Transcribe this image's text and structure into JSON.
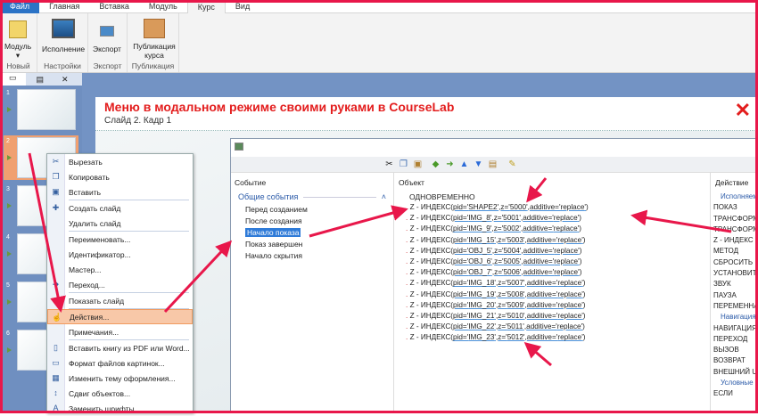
{
  "ribbon": {
    "tabs": [
      "Файл",
      "Главная",
      "Вставка",
      "Модуль",
      "Курс",
      "Вид"
    ],
    "active_tab": "Курс",
    "groups": [
      {
        "label": "Новый",
        "buttons": [
          "Модуль"
        ]
      },
      {
        "label": "Настройки",
        "buttons": [
          "Исполнение"
        ]
      },
      {
        "label": "Экспорт",
        "buttons": [
          "Экспорт"
        ]
      },
      {
        "label": "Публикация",
        "buttons": [
          "Публикация курса"
        ]
      }
    ]
  },
  "slides": {
    "numbers": [
      "1",
      "2",
      "3",
      "4",
      "5",
      "6"
    ],
    "selected": "2"
  },
  "slide": {
    "title": "Меню в модальном режиме своими руками в CourseLab",
    "subtitle": "Слайд 2. Кадр 1",
    "close": "✕"
  },
  "context_menu": {
    "items": [
      "Вырезать",
      "Копировать",
      "Вставить",
      "Создать слайд",
      "Удалить слайд",
      "Переименовать...",
      "Идентификатор...",
      "Мастер...",
      "Переход...",
      "Показать слайд",
      "Действия...",
      "Примечания...",
      "Вставить книгу из PDF или Word...",
      "Формат файлов картинок...",
      "Изменить тему оформления...",
      "Сдвиг объектов...",
      "Заменить шрифты..."
    ],
    "highlighted": "Действия..."
  },
  "dialog": {
    "event_header": "Событие",
    "event_group": "Общие события",
    "events": [
      "Перед созданием",
      "После создания",
      "Начало показа",
      "Показ завершен",
      "Начало скрытия"
    ],
    "selected_event": "Начало показа",
    "object_header": "Объект",
    "root": "ОДНОВРЕМЕННО",
    "actions": [
      {
        "name": "Z - ИНДЕКС",
        "pid": "SHAPE2",
        "z": "5000"
      },
      {
        "name": "Z - ИНДЕКС",
        "pid": "IMG_8",
        "z": "5001"
      },
      {
        "name": "Z - ИНДЕКС",
        "pid": "IMG_9",
        "z": "5002"
      },
      {
        "name": "Z - ИНДЕКС",
        "pid": "IMG_15",
        "z": "5003"
      },
      {
        "name": "Z - ИНДЕКС",
        "pid": "OBJ_5",
        "z": "5004"
      },
      {
        "name": "Z - ИНДЕКС",
        "pid": "OBJ_6",
        "z": "5005"
      },
      {
        "name": "Z - ИНДЕКС",
        "pid": "OBJ_7",
        "z": "5006"
      },
      {
        "name": "Z - ИНДЕКС",
        "pid": "IMG_18",
        "z": "5007"
      },
      {
        "name": "Z - ИНДЕКС",
        "pid": "IMG_19",
        "z": "5008"
      },
      {
        "name": "Z - ИНДЕКС",
        "pid": "IMG_20",
        "z": "5009"
      },
      {
        "name": "Z - ИНДЕКС",
        "pid": "IMG_21",
        "z": "5010"
      },
      {
        "name": "Z - ИНДЕКС",
        "pid": "IMG_22",
        "z": "5011"
      },
      {
        "name": "Z - ИНДЕКС",
        "pid": "IMG_23",
        "z": "5012"
      }
    ],
    "additive": "replace",
    "action_header": "Действие",
    "action_groups": [
      {
        "label": "Исполняемые",
        "items": [
          "ПОКАЗ",
          "ТРАНСФОРМАЦИЯ",
          "ТРАНСФОРМАЦИЯ",
          "Z - ИНДЕКС",
          "МЕТОД",
          "СБРОСИТЬ",
          "УСТАНОВИТЬ",
          "ЗВУК",
          "ПАУЗА",
          "ПЕРЕМЕННАЯ"
        ]
      },
      {
        "label": "Навигация",
        "items": [
          "НАВИГАЦИЯ",
          "ПЕРЕХОД",
          "ВЫЗОВ",
          "ВОЗВРАТ",
          "ВНЕШНИЙ URL"
        ]
      },
      {
        "label": "Условные",
        "items": [
          "ЕСЛИ"
        ]
      }
    ]
  },
  "colors": {
    "accent": "#e8174a",
    "file_tab": "#2b73c6",
    "selection": "#2f7bd8"
  }
}
